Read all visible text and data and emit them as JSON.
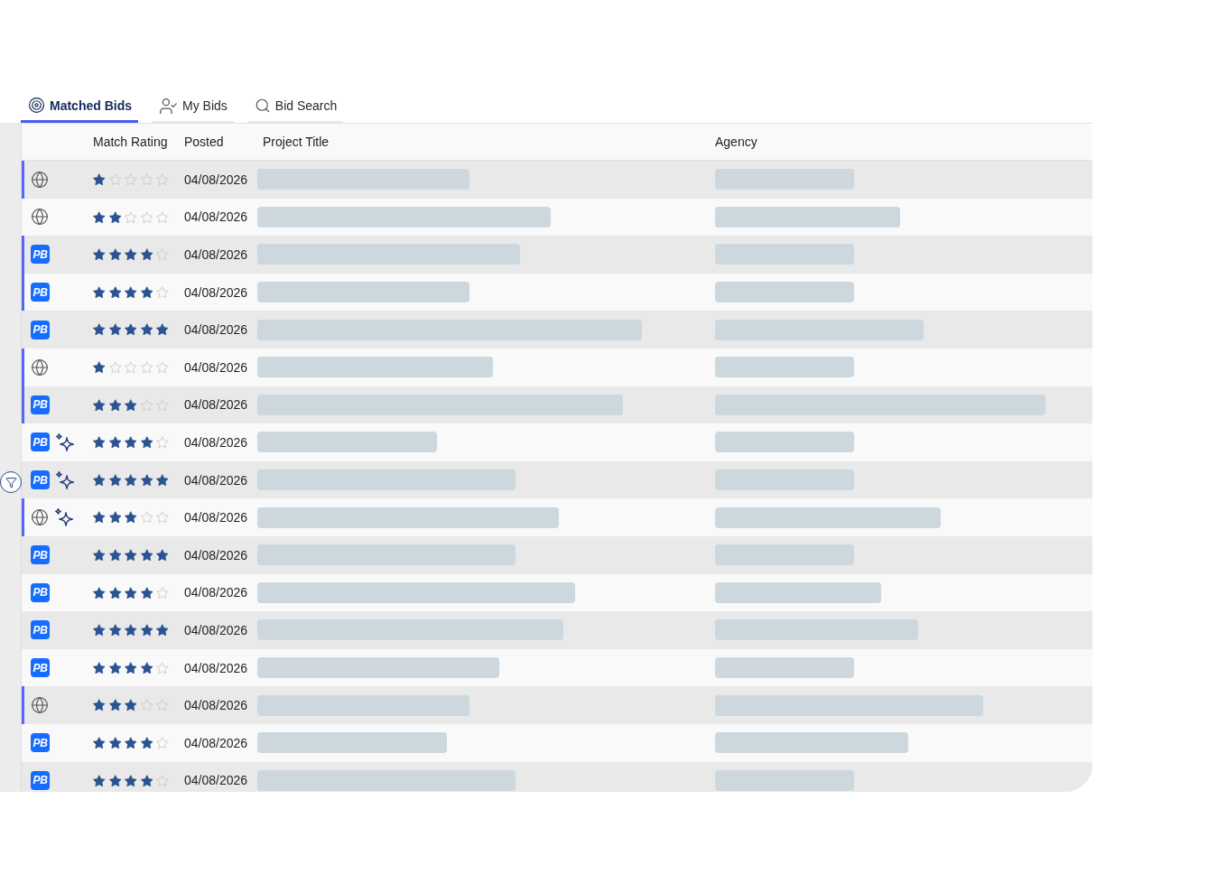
{
  "tabs": [
    {
      "label": "Matched Bids",
      "selected": true
    },
    {
      "label": "My Bids",
      "selected": false
    },
    {
      "label": "Bid Search",
      "selected": false
    }
  ],
  "table": {
    "columns": [
      "Match Rating",
      "Posted",
      "Project Title",
      "Agency"
    ],
    "rows": [
      {
        "source": {
          "kind": "globe"
        },
        "marked": true,
        "sparkle": false,
        "stars": 1,
        "posted": "04/08/2026"
      },
      {
        "source": {
          "kind": "globe"
        },
        "marked": false,
        "sparkle": false,
        "stars": 2,
        "posted": "04/08/2026"
      },
      {
        "source": {
          "kind": "badge",
          "text": "PB"
        },
        "marked": true,
        "sparkle": false,
        "stars": 4,
        "posted": "04/08/2026"
      },
      {
        "source": {
          "kind": "badge",
          "text": "PB"
        },
        "marked": true,
        "sparkle": false,
        "stars": 4,
        "posted": "04/08/2026"
      },
      {
        "source": {
          "kind": "badge",
          "text": "PB"
        },
        "marked": false,
        "sparkle": false,
        "stars": 5,
        "posted": "04/08/2026"
      },
      {
        "source": {
          "kind": "globe"
        },
        "marked": true,
        "sparkle": false,
        "stars": 1,
        "posted": "04/08/2026"
      },
      {
        "source": {
          "kind": "badge",
          "text": "PB"
        },
        "marked": true,
        "sparkle": false,
        "stars": 3,
        "posted": "04/08/2026"
      },
      {
        "source": {
          "kind": "badge",
          "text": "PB"
        },
        "marked": false,
        "sparkle": true,
        "stars": 4,
        "posted": "04/08/2026"
      },
      {
        "source": {
          "kind": "badge",
          "text": "PB"
        },
        "marked": false,
        "sparkle": true,
        "stars": 5,
        "posted": "04/08/2026"
      },
      {
        "source": {
          "kind": "globe"
        },
        "marked": true,
        "sparkle": true,
        "stars": 3,
        "posted": "04/08/2026"
      },
      {
        "source": {
          "kind": "badge",
          "text": "PB"
        },
        "marked": false,
        "sparkle": false,
        "stars": 5,
        "posted": "04/08/2026"
      },
      {
        "source": {
          "kind": "badge",
          "text": "PB"
        },
        "marked": false,
        "sparkle": false,
        "stars": 4,
        "posted": "04/08/2026"
      },
      {
        "source": {
          "kind": "badge",
          "text": "PB"
        },
        "marked": false,
        "sparkle": false,
        "stars": 5,
        "posted": "04/08/2026"
      },
      {
        "source": {
          "kind": "badge",
          "text": "PB"
        },
        "marked": false,
        "sparkle": false,
        "stars": 4,
        "posted": "04/08/2026"
      },
      {
        "source": {
          "kind": "globe"
        },
        "marked": true,
        "sparkle": false,
        "stars": 3,
        "posted": "04/08/2026"
      },
      {
        "source": {
          "kind": "badge",
          "text": "PB"
        },
        "marked": false,
        "sparkle": false,
        "stars": 4,
        "posted": "04/08/2026"
      },
      {
        "source": {
          "kind": "badge",
          "text": "PB"
        },
        "marked": false,
        "sparkle": false,
        "stars": 4,
        "posted": "04/08/2026"
      }
    ]
  }
}
